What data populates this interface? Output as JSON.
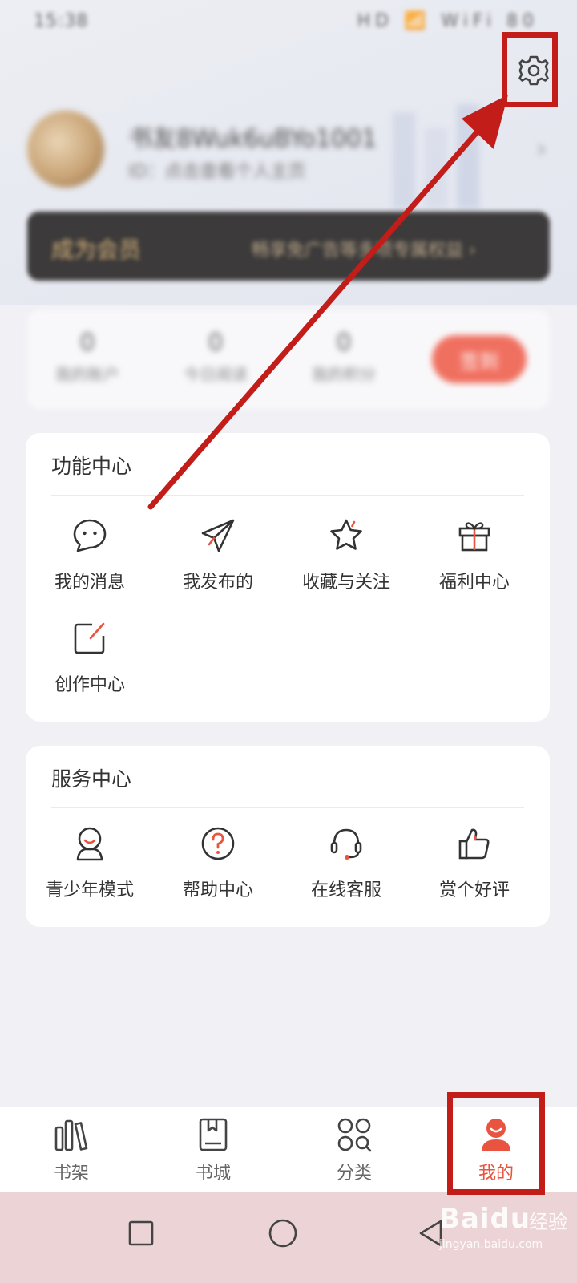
{
  "status_bar": {
    "time": "15:38",
    "icons": "HD 📶 WiFi 80"
  },
  "profile": {
    "username": "书友8Wuk6uBYo1001",
    "subtitle": "ID：点击查看个人主页",
    "chevron": "›"
  },
  "vip": {
    "title": "成为会员",
    "description": "畅享免广告等多项专属权益 ›"
  },
  "stats": [
    {
      "num": "0",
      "label": "我的账户"
    },
    {
      "num": "0",
      "label": "今日阅读"
    },
    {
      "num": "0",
      "label": "我的积分"
    }
  ],
  "checkin_label": "签到",
  "function_center": {
    "title": "功能中心",
    "items": [
      {
        "label": "我的消息",
        "icon": "message-bubble-icon"
      },
      {
        "label": "我发布的",
        "icon": "paper-plane-icon"
      },
      {
        "label": "收藏与关注",
        "icon": "star-icon"
      },
      {
        "label": "福利中心",
        "icon": "gift-icon"
      },
      {
        "label": "创作中心",
        "icon": "edit-icon"
      }
    ]
  },
  "service_center": {
    "title": "服务中心",
    "items": [
      {
        "label": "青少年模式",
        "icon": "teen-mode-icon"
      },
      {
        "label": "帮助中心",
        "icon": "help-icon"
      },
      {
        "label": "在线客服",
        "icon": "headset-icon"
      },
      {
        "label": "赏个好评",
        "icon": "thumbs-up-icon"
      }
    ]
  },
  "tabbar": [
    {
      "label": "书架",
      "icon": "bookshelf-icon",
      "active": false
    },
    {
      "label": "书城",
      "icon": "bookstore-icon",
      "active": false
    },
    {
      "label": "分类",
      "icon": "category-icon",
      "active": false
    },
    {
      "label": "我的",
      "icon": "profile-icon",
      "active": true
    }
  ],
  "watermark": {
    "logo": "Baidu",
    "text": "经验",
    "url": "jingyan.baidu.com"
  },
  "colors": {
    "accent": "#e8543f",
    "annotation_red": "#c31d19",
    "icon_dark": "#333333"
  }
}
